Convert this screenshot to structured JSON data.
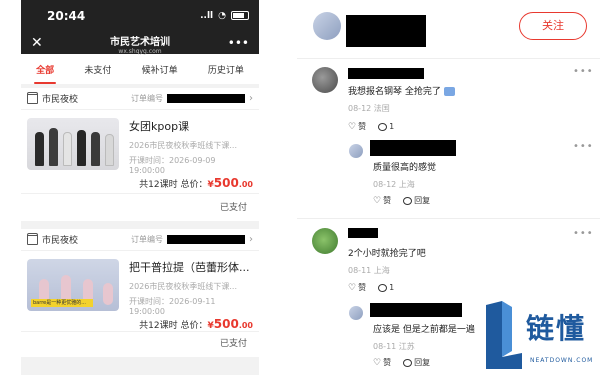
{
  "status_bar": {
    "time": "20:44",
    "signal": "..ll"
  },
  "navbar": {
    "close": "✕",
    "title": "市民艺术培训",
    "subtitle": "wx.shqyg.com",
    "more": "•••"
  },
  "tabs": [
    {
      "label": "全部",
      "active": true
    },
    {
      "label": "未支付",
      "active": false
    },
    {
      "label": "候补订单",
      "active": false
    },
    {
      "label": "历史订单",
      "active": false
    }
  ],
  "orders": [
    {
      "shop": "市民夜校",
      "order_label": "订单编号",
      "title": "女团kpop课",
      "subtitle": "2026市民夜校秋季班线下课...",
      "start_time": "开课时间：2026-09-09 19:00:00",
      "summary": "共12课时 总价：",
      "currency": "¥",
      "price_int": "500",
      "price_dec": ".00",
      "status": "已支付"
    },
    {
      "shop": "市民夜校",
      "order_label": "订单编号",
      "title": "把干普拉提（芭蕾形体...",
      "subtitle": "2026市民夜校秋季班线下课...",
      "start_time": "开课时间：2026-09-11 19:00:00",
      "summary": "共12课时 总价：",
      "currency": "¥",
      "price_int": "500",
      "price_dec": ".00",
      "status": "已支付",
      "banner": "barre是一种更优雅的..."
    }
  ],
  "post": {
    "follow_label": "关注"
  },
  "comments": [
    {
      "text": "我想报名钢琴 全抢完了",
      "meta": "08-12 法国",
      "like_label": "赞",
      "reply_count": "1",
      "replies": [
        {
          "text": "质量很高的感觉",
          "meta": "08-12 上海",
          "like_label": "赞",
          "reply_label": "回复"
        }
      ]
    },
    {
      "text": "2个小时就抢完了吧",
      "meta": "08-11 上海",
      "like_label": "赞",
      "reply_count": "1",
      "replies": [
        {
          "text": "应该是 但是之前都是一遍",
          "meta": "08-11 江苏",
          "like_label": "赞",
          "reply_label": "回复"
        }
      ]
    }
  ],
  "watermark": {
    "text": "链懂",
    "sub": "NEATDOWN.COM"
  },
  "colors": {
    "accent": "#e8392f",
    "dark_header": "#222222",
    "logo_blue": "#1f5a9e"
  }
}
